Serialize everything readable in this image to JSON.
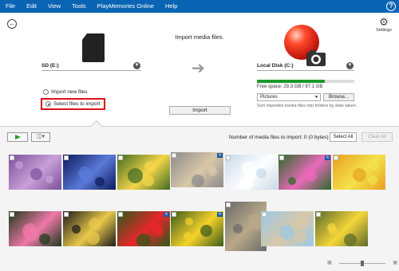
{
  "menu": [
    "File",
    "Edit",
    "View",
    "Tools",
    "PlayMemories Online",
    "Help"
  ],
  "help_label": "?",
  "settings_label": "Settings",
  "headline": "Import media files.",
  "source": {
    "device": "SD (E:)",
    "options": [
      "Import new files",
      "Select files to import"
    ],
    "selected": "Select files to import"
  },
  "import_label": "Import",
  "destination": {
    "disk": "Local Disk (C:)",
    "free_space": "Free space: 29.3 GB / 97.1 GB",
    "used_fraction": 0.7,
    "folder": "Pictures",
    "browse_label": "Browse...",
    "sort_note": "Sort imported media files into folders by date taken."
  },
  "media": {
    "count_text": "Number of media files to import: 0 (0 bytes)",
    "select_all": "Select All",
    "clear_all": "Clear All"
  },
  "thumbnails": [
    {
      "subject": "purple roses",
      "colors": [
        "#7a4f9a",
        "#c9a0d8"
      ],
      "tag": false
    },
    {
      "subject": "illuminated trees",
      "colors": [
        "#0b1a5a",
        "#5a7ad8"
      ],
      "tag": false
    },
    {
      "subject": "yellow flowers",
      "colors": [
        "#3d6a22",
        "#f4d64a"
      ],
      "tag": false
    },
    {
      "subject": "cat",
      "colors": [
        "#8a8a8a",
        "#d8c8a8"
      ],
      "tag": true
    },
    {
      "subject": "white flowers",
      "colors": [
        "#c8d8e8",
        "#ffffff"
      ],
      "tag": false
    },
    {
      "subject": "pink flowers",
      "colors": [
        "#2a6a2a",
        "#e86ab8"
      ],
      "tag": true
    },
    {
      "subject": "sunflower",
      "colors": [
        "#e8a022",
        "#f4e24a"
      ],
      "tag": false
    },
    {
      "subject": "pink lotus",
      "colors": [
        "#1a3a1a",
        "#f078a8"
      ],
      "tag": false
    },
    {
      "subject": "flowers at night",
      "colors": [
        "#1a1a1a",
        "#e8c84a"
      ],
      "tag": false
    },
    {
      "subject": "red tulips",
      "colors": [
        "#2a5a1a",
        "#e8262a"
      ],
      "tag": true
    },
    {
      "subject": "yellow daffodils",
      "colors": [
        "#3a5a1a",
        "#f4d22a"
      ],
      "tag": true
    },
    {
      "subject": "cat on ledge",
      "colors": [
        "#6a6a6a",
        "#b8a888"
      ],
      "tag": false
    },
    {
      "subject": "beach",
      "colors": [
        "#9ac8e8",
        "#d8c8a8"
      ],
      "tag": false
    },
    {
      "subject": "cat in yellow flowers",
      "colors": [
        "#5a6a2a",
        "#f4d63a"
      ],
      "tag": false
    }
  ]
}
